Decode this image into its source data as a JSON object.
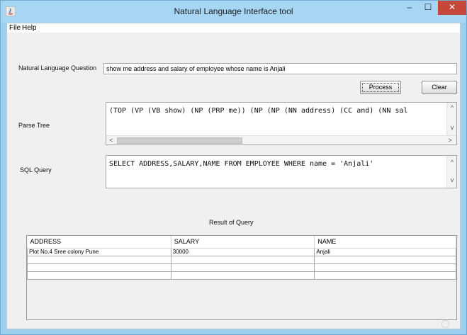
{
  "window": {
    "title": "Natural Language Interface tool",
    "controls": {
      "minimize": "–",
      "maximize": "☐",
      "close": "✕"
    }
  },
  "menu": {
    "items": [
      "File",
      "Help"
    ]
  },
  "question": {
    "label": "Natural Language Question",
    "value": "show me address and salary of employee whose name is Anjali"
  },
  "buttons": {
    "process": "Process",
    "clear": "Clear"
  },
  "parse_tree": {
    "label": "Parse Tree",
    "text": "(TOP (VP (VB show) (NP (PRP me)) (NP (NP (NN address) (CC and) (NN sal"
  },
  "sql": {
    "label": "SQL Query",
    "text": "SELECT ADDRESS,SALARY,NAME FROM EMPLOYEE WHERE name = 'Anjali'"
  },
  "result": {
    "title": "Result of Query",
    "columns": [
      "ADDRESS",
      "SALARY",
      "NAME"
    ],
    "rows": [
      [
        "Plot No.4 Sree colony Pune",
        "30000",
        "Anjali"
      ],
      [
        "",
        "",
        ""
      ],
      [
        "",
        "",
        ""
      ],
      [
        "",
        "",
        ""
      ]
    ]
  },
  "icons": [
    "java-app-icon",
    "up-arrow-icon",
    "down-arrow-icon",
    "left-arrow-icon",
    "right-arrow-icon",
    "busy-circle-icon"
  ],
  "colors": {
    "titlebar": "#a6d6f4",
    "close": "#c7463a",
    "panel": "#f0f0f0"
  }
}
